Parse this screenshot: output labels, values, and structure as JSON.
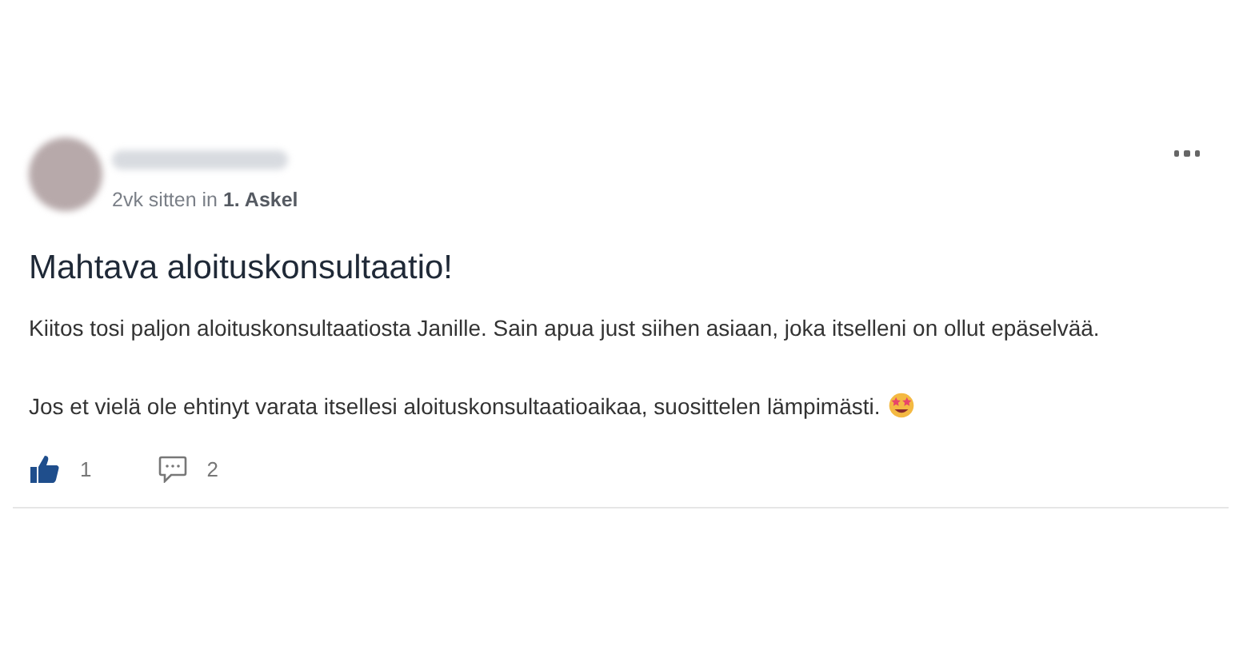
{
  "post": {
    "meta": "2vk sitten in **1. Askel**",
    "title": "Mahtava aloituskonsultaatio!",
    "paragraphs": [
      "Kiitos tosi paljon aloituskonsultaatiosta Janille. Sain apua just siihen asiaan, joka itselleni on ollut epäselvää.",
      "Jos et vielä ole ehtinyt varata itsellesi aloituskonsultaatioaikaa, suosittelen lämpimästi."
    ],
    "likes": {
      "count": "1",
      "liked": true
    },
    "comments": {
      "count": "2"
    }
  }
}
